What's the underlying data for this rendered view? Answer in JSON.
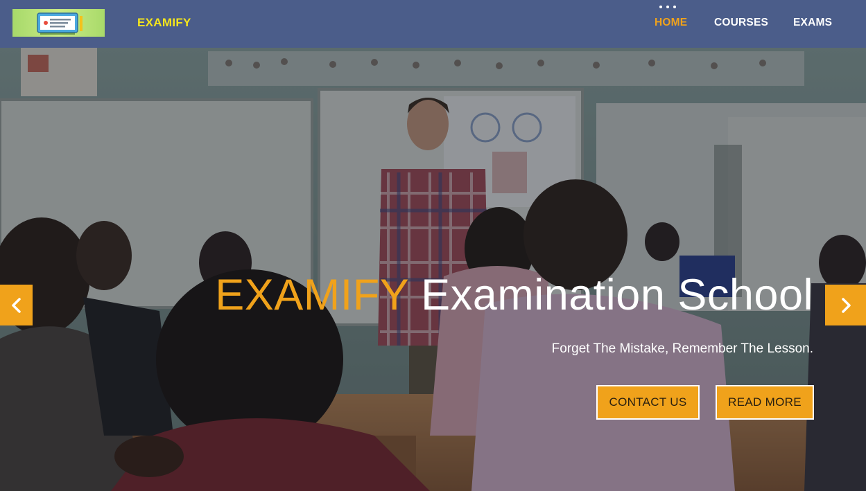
{
  "header": {
    "brand": "EXAMIFY",
    "nav": [
      {
        "label": "HOME",
        "active": true
      },
      {
        "label": "COURSES",
        "active": false
      },
      {
        "label": "EXAMS",
        "active": false
      }
    ]
  },
  "hero": {
    "title_accent": "EXAMIFY",
    "title_rest": "Examination School",
    "subtitle": "Forget The Mistake, Remember The Lesson.",
    "buttons": {
      "contact": "CONTACT US",
      "read_more": "READ MORE"
    }
  },
  "icons": {
    "prev": "chevron-left-icon",
    "next": "chevron-right-icon",
    "menu": "dots-icon"
  },
  "colors": {
    "navbar": "#4b5d8a",
    "brand": "#f5e61b",
    "accent": "#f0a21b",
    "text": "#ffffff"
  }
}
